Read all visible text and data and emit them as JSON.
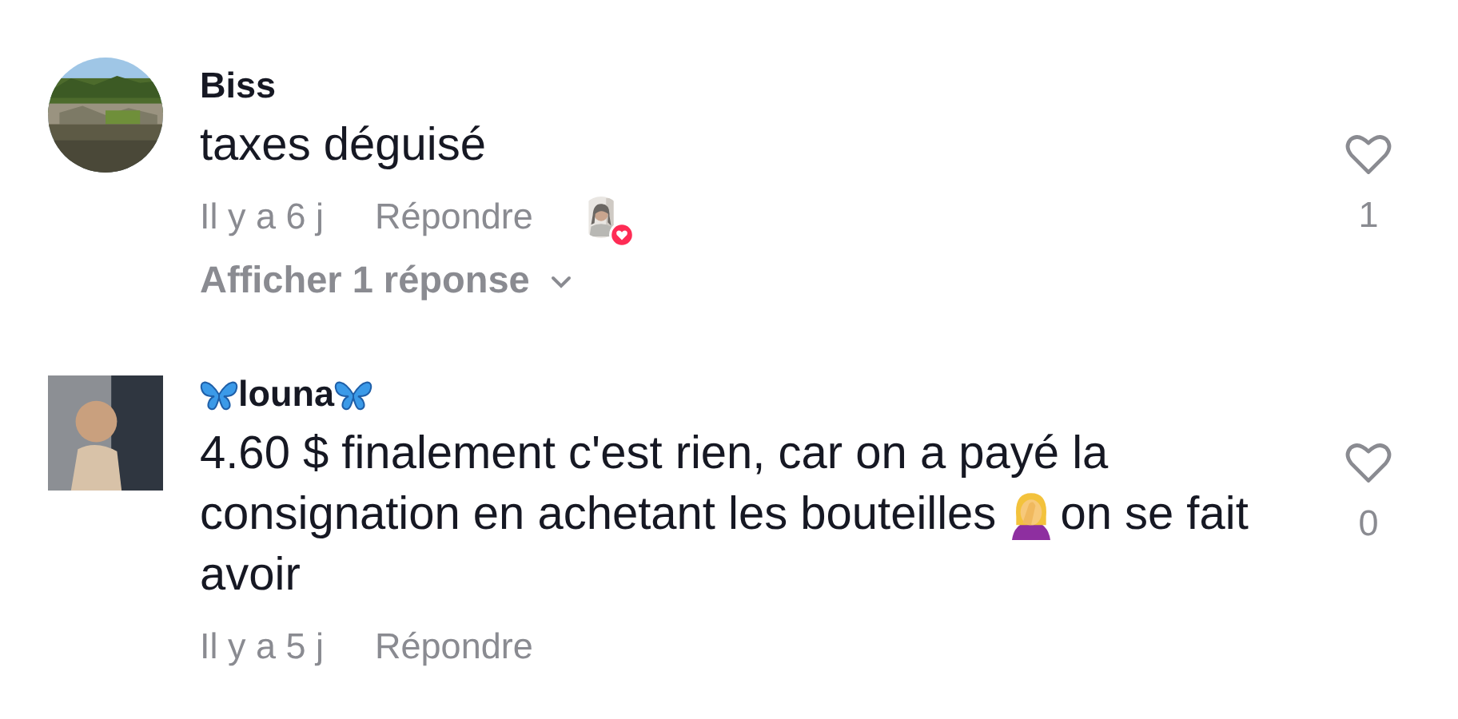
{
  "comments": [
    {
      "avatar": {
        "kind": "picture"
      },
      "author": [
        {
          "kind": "text",
          "text": "Biss"
        }
      ],
      "lines": [
        [
          {
            "kind": "text",
            "text": "taxes déguisé"
          }
        ]
      ],
      "time": "Il y a 6 j",
      "reply_label": "Répondre",
      "liked_by_author": true,
      "replies_label": "Afficher 1 réponse",
      "liked": false,
      "likes": "1"
    },
    {
      "avatar": {
        "kind": "picture"
      },
      "author": [
        {
          "kind": "butterfly"
        },
        {
          "kind": "text",
          "text": "louna"
        },
        {
          "kind": "butterfly"
        }
      ],
      "lines": [
        [
          {
            "kind": "text",
            "text": "4.60 $ finalement c'est rien, car on a payé la"
          }
        ],
        [
          {
            "kind": "text",
            "text": "consignation en achetant les bouteilles"
          },
          {
            "kind": "facepalm"
          },
          {
            "kind": "text",
            "text": "on se fait"
          }
        ],
        [
          {
            "kind": "text",
            "text": "avoir"
          }
        ]
      ],
      "time": "Il y a 5 j",
      "reply_label": "Répondre",
      "liked_by_author": false,
      "liked": false,
      "likes": "0"
    }
  ]
}
